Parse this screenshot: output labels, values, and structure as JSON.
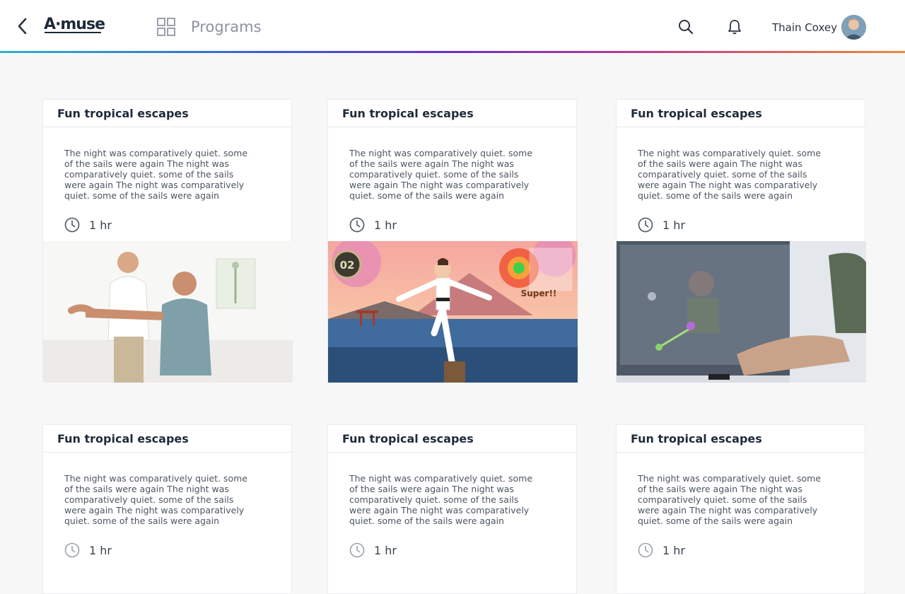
{
  "header": {
    "logo_text": "A·muse",
    "section_title": "Programs",
    "user_name": "Thain Coxey"
  },
  "cards": [
    {
      "title": "Fun tropical escapes",
      "description": "The night was comparatively quiet. some of the sails were again The night was comparatively quiet. some of the sails were again The night was comparatively quiet. some of the sails were again",
      "duration": "1 hr",
      "image": "physiotherapy-photo"
    },
    {
      "title": "Fun tropical escapes",
      "description": "The night was comparatively quiet. some of the sails were again The night was comparatively quiet. some of the sails were again The night was comparatively quiet. some of the sails were again",
      "duration": "1 hr",
      "image": "karate-game-scene",
      "game_badge": "02",
      "game_text": "Super!!"
    },
    {
      "title": "Fun tropical escapes",
      "description": "The night was comparatively quiet. some of the sails were again The night was comparatively quiet. some of the sails were again The night was comparatively quiet. some of the sails were again",
      "duration": "1 hr",
      "image": "motion-tracking-screen-photo"
    },
    {
      "title": "Fun tropical escapes",
      "description": "The night was comparatively quiet. some of the sails were again The night was comparatively quiet. some of the sails were again The night was comparatively quiet. some of the sails were again",
      "duration": "1 hr"
    },
    {
      "title": "Fun tropical escapes",
      "description": "The night was comparatively quiet. some of the sails were again The night was comparatively quiet. some of the sails were again The night was comparatively quiet. some of the sails were again",
      "duration": "1 hr"
    },
    {
      "title": "Fun tropical escapes",
      "description": "The night was comparatively quiet. some of the sails were again The night was comparatively quiet. some of the sails were again The night was comparatively quiet. some of the sails were again",
      "duration": "1 hr"
    }
  ],
  "colors": {
    "accent_gradient": [
      "#2bb6c9",
      "#3b5bd6",
      "#6a2fd0",
      "#c43b8a",
      "#f08a3a"
    ],
    "text_dark": "#1f2a3a",
    "muted": "#8b93a0"
  }
}
